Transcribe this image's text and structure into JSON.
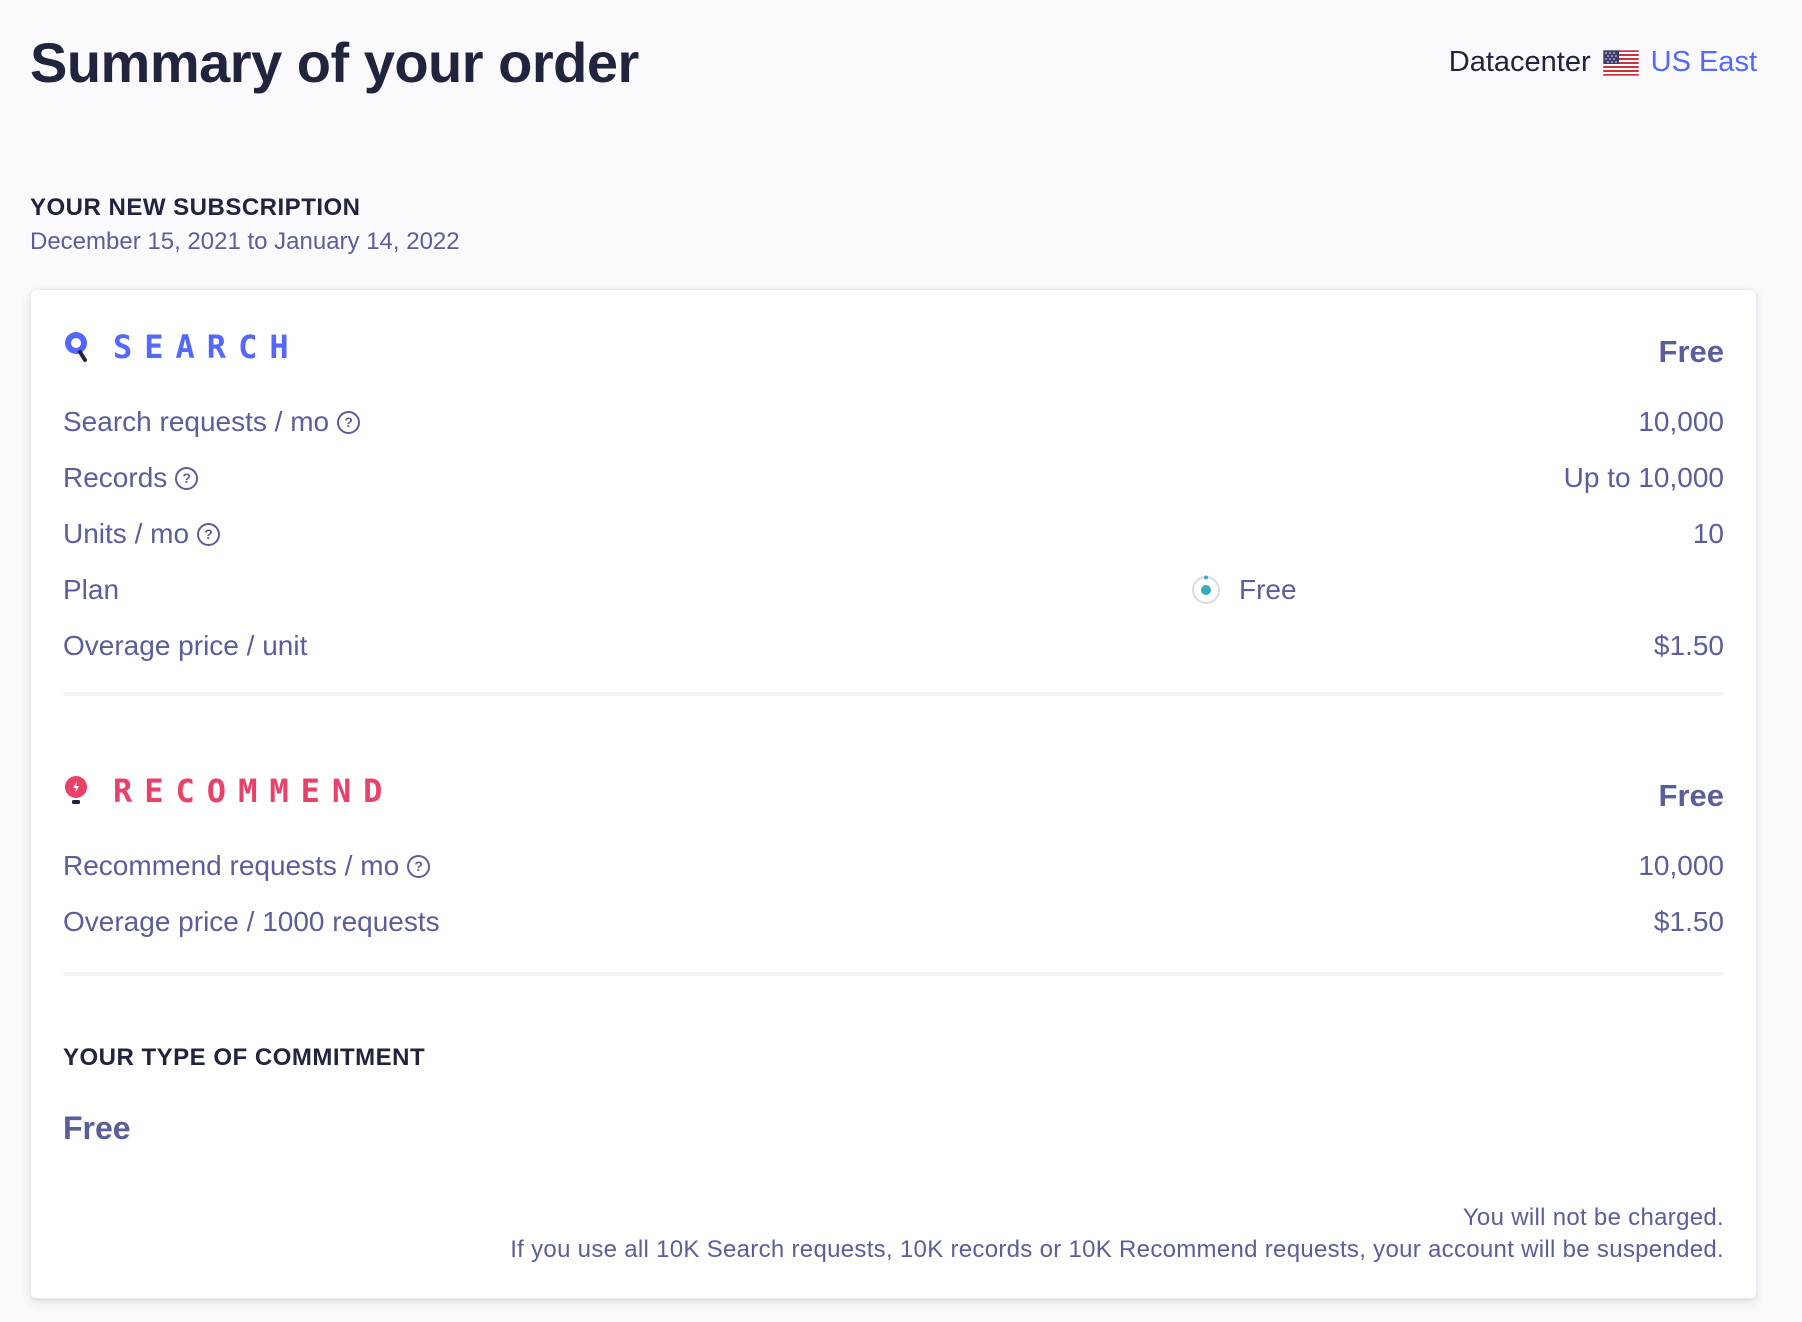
{
  "header": {
    "title": "Summary of your order",
    "datacenter_label": "Datacenter",
    "datacenter_flag_icon": "us-flag-icon",
    "datacenter_value": "US East"
  },
  "subscription": {
    "heading": "YOUR NEW SUBSCRIPTION",
    "dates": "December 15, 2021 to January 14, 2022"
  },
  "search": {
    "name": "SEARCH",
    "icon": "search-magnifier-icon",
    "price": "Free",
    "color": "#5468ff",
    "rows": [
      {
        "label": "Search requests / mo",
        "help": true,
        "value": "10,000"
      },
      {
        "label": "Records",
        "help": true,
        "value": "Up to 10,000"
      },
      {
        "label": "Units / mo",
        "help": true,
        "value": "10"
      },
      {
        "label": "Plan",
        "help": false,
        "value": "Free"
      },
      {
        "label": "Overage price / unit",
        "help": false,
        "value": "$1.50"
      }
    ]
  },
  "recommend": {
    "name": "RECOMMEND",
    "icon": "recommend-lightbulb-icon",
    "price": "Free",
    "color": "#e8426b",
    "rows": [
      {
        "label": "Recommend requests / mo",
        "help": true,
        "value": "10,000"
      },
      {
        "label": "Overage price / 1000 requests",
        "help": false,
        "value": "$1.50"
      }
    ]
  },
  "commitment": {
    "heading": "YOUR TYPE OF COMMITMENT",
    "value": "Free"
  },
  "notes": {
    "line1": "You will not be charged.",
    "line2": "If you use all 10K Search requests, 10K records or 10K Recommend requests, your account will be suspended."
  },
  "help_icon_glyph": "?"
}
